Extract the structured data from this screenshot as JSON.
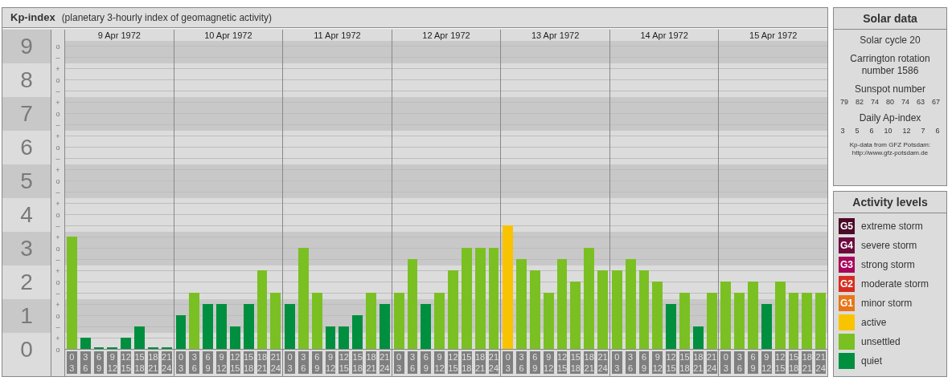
{
  "header": {
    "title": "Kp-index",
    "subtitle": "(planetary 3-hourly index of geomagnetic activity)"
  },
  "chart": {
    "y_marks": [
      "o",
      "–",
      "+",
      "o",
      "–",
      "+",
      "o",
      "–",
      "+",
      "o",
      "–",
      "+",
      "o",
      "–",
      "+",
      "o",
      "–",
      "+",
      "o",
      "–",
      "+",
      "o",
      "–",
      "+",
      "o",
      "–",
      "+",
      "o"
    ],
    "days": [
      "9 Apr 1972",
      "10 Apr 1972",
      "11 Apr 1972",
      "12 Apr 1972",
      "13 Apr 1972",
      "14 Apr 1972",
      "15 Apr 1972"
    ],
    "chart_data": {
      "type": "bar",
      "ylim": [
        0,
        9
      ],
      "yticks": [
        0,
        1,
        2,
        3,
        4,
        5,
        6,
        7,
        8,
        9
      ],
      "categories": [
        "0 3",
        "3 6",
        "6 9",
        "9 12",
        "12 15",
        "15 18",
        "18 21",
        "21 24",
        "0 3",
        "3 6",
        "6 9",
        "9 12",
        "12 15",
        "15 18",
        "18 21",
        "21 24",
        "0 3",
        "3 6",
        "6 9",
        "9 12",
        "12 15",
        "15 18",
        "18 21",
        "21 24",
        "0 3",
        "3 6",
        "6 9",
        "9 12",
        "12 15",
        "15 18",
        "18 21",
        "21 24",
        "0 3",
        "3 6",
        "6 9",
        "9 12",
        "12 15",
        "15 18",
        "18 21",
        "21 24",
        "0 3",
        "3 6",
        "6 9",
        "9 12",
        "12 15",
        "15 18",
        "18 21",
        "21 24",
        "0 3",
        "3 6",
        "6 9",
        "9 12",
        "12 15",
        "15 18",
        "18 21",
        "21 24"
      ],
      "values": [
        3.33,
        0.33,
        0,
        0,
        0.33,
        0.67,
        0,
        0,
        1,
        1.67,
        1.33,
        1.33,
        0.67,
        1.33,
        2.33,
        1.67,
        1.33,
        3,
        1.67,
        0.67,
        0.67,
        1,
        1.67,
        1.33,
        1.67,
        2.67,
        1.33,
        1.67,
        2.33,
        3,
        3,
        3,
        3.67,
        2.67,
        2.33,
        1.67,
        2.67,
        2,
        3,
        2.33,
        2.33,
        2.67,
        2.33,
        2,
        1.33,
        1.67,
        0.67,
        1.67,
        2,
        1.67,
        2,
        1.33,
        2,
        1.67,
        1.67,
        1.67
      ]
    }
  },
  "solar": {
    "title": "Solar data",
    "cycle": "Solar cycle 20",
    "rotation": "Carrington rotation number 1586",
    "sunspot_title": "Sunspot number",
    "sunspots": [
      "79",
      "82",
      "74",
      "80",
      "74",
      "63",
      "67"
    ],
    "ap_title": "Daily Ap-index",
    "ap": [
      "3",
      "5",
      "6",
      "10",
      "12",
      "7",
      "6"
    ],
    "source": "Kp-data from GFZ Potsdam:",
    "source_url": "http://www.gfz-potsdam.de"
  },
  "legend": {
    "title": "Activity levels",
    "items": [
      {
        "badge": "G5",
        "label": "extreme storm",
        "color": "#4a0a28"
      },
      {
        "badge": "G4",
        "label": "severe storm",
        "color": "#6d0a3f"
      },
      {
        "badge": "G3",
        "label": "strong storm",
        "color": "#a8065a"
      },
      {
        "badge": "G2",
        "label": "moderate storm",
        "color": "#d62d20"
      },
      {
        "badge": "G1",
        "label": "minor storm",
        "color": "#e8761a"
      },
      {
        "label": "active",
        "color": "#f9c300"
      },
      {
        "label": "unsettled",
        "color": "#7ac022"
      },
      {
        "label": "quiet",
        "color": "#008f3f"
      }
    ]
  }
}
